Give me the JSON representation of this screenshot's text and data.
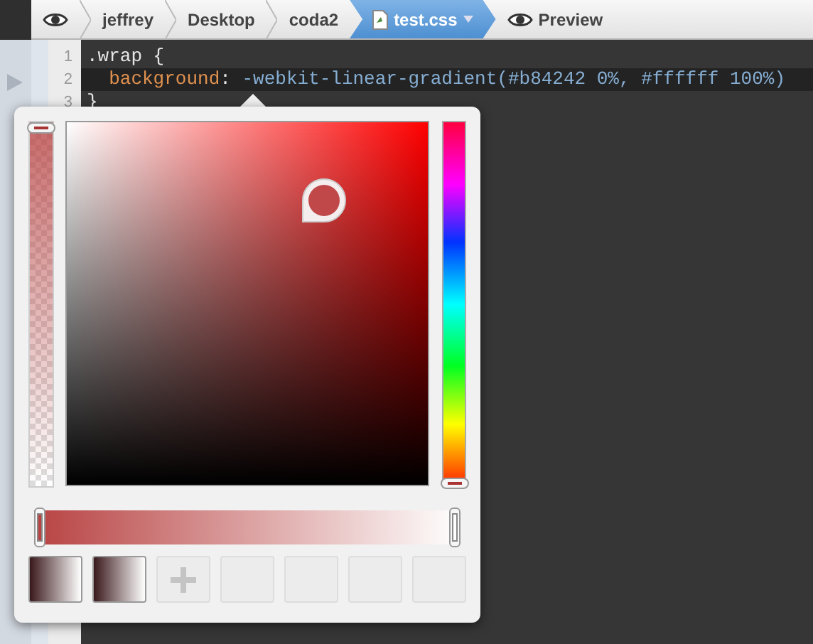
{
  "breadcrumb": [
    {
      "kind": "eye",
      "selected": false
    },
    {
      "kind": "folder",
      "label": "jeffrey",
      "selected": false
    },
    {
      "kind": "folder",
      "label": "Desktop",
      "selected": false
    },
    {
      "kind": "folder",
      "label": "coda2",
      "selected": false
    },
    {
      "kind": "file",
      "label": "test.css",
      "selected": true
    },
    {
      "kind": "preview",
      "label": "Preview",
      "selected": false
    }
  ],
  "editor": {
    "lines": [
      {
        "number": "1",
        "highlighted": false,
        "tokens": [
          {
            "kind": "selector",
            "text": ".wrap {"
          }
        ]
      },
      {
        "number": "2",
        "highlighted": true,
        "tokens": [
          {
            "kind": "property",
            "text": "  background"
          },
          {
            "kind": "punct",
            "text": ": "
          },
          {
            "kind": "value",
            "text": "-webkit-linear-gradient(#b84242 0%, #ffffff 100%)"
          }
        ]
      },
      {
        "number": "3",
        "highlighted": false,
        "tokens": [
          {
            "kind": "punct",
            "text": "}"
          }
        ]
      }
    ]
  },
  "color_picker": {
    "alpha": {
      "level": 1
    },
    "hue_slider": {
      "level": 0
    },
    "gradient_stops": [
      {
        "color": "#b84242"
      },
      {
        "color": "#ffffff"
      }
    ],
    "swatches": [
      {
        "kind": "gradient"
      },
      {
        "kind": "gradient"
      },
      {
        "kind": "add"
      },
      {
        "kind": "empty"
      },
      {
        "kind": "empty"
      },
      {
        "kind": "empty"
      },
      {
        "kind": "empty"
      }
    ]
  }
}
